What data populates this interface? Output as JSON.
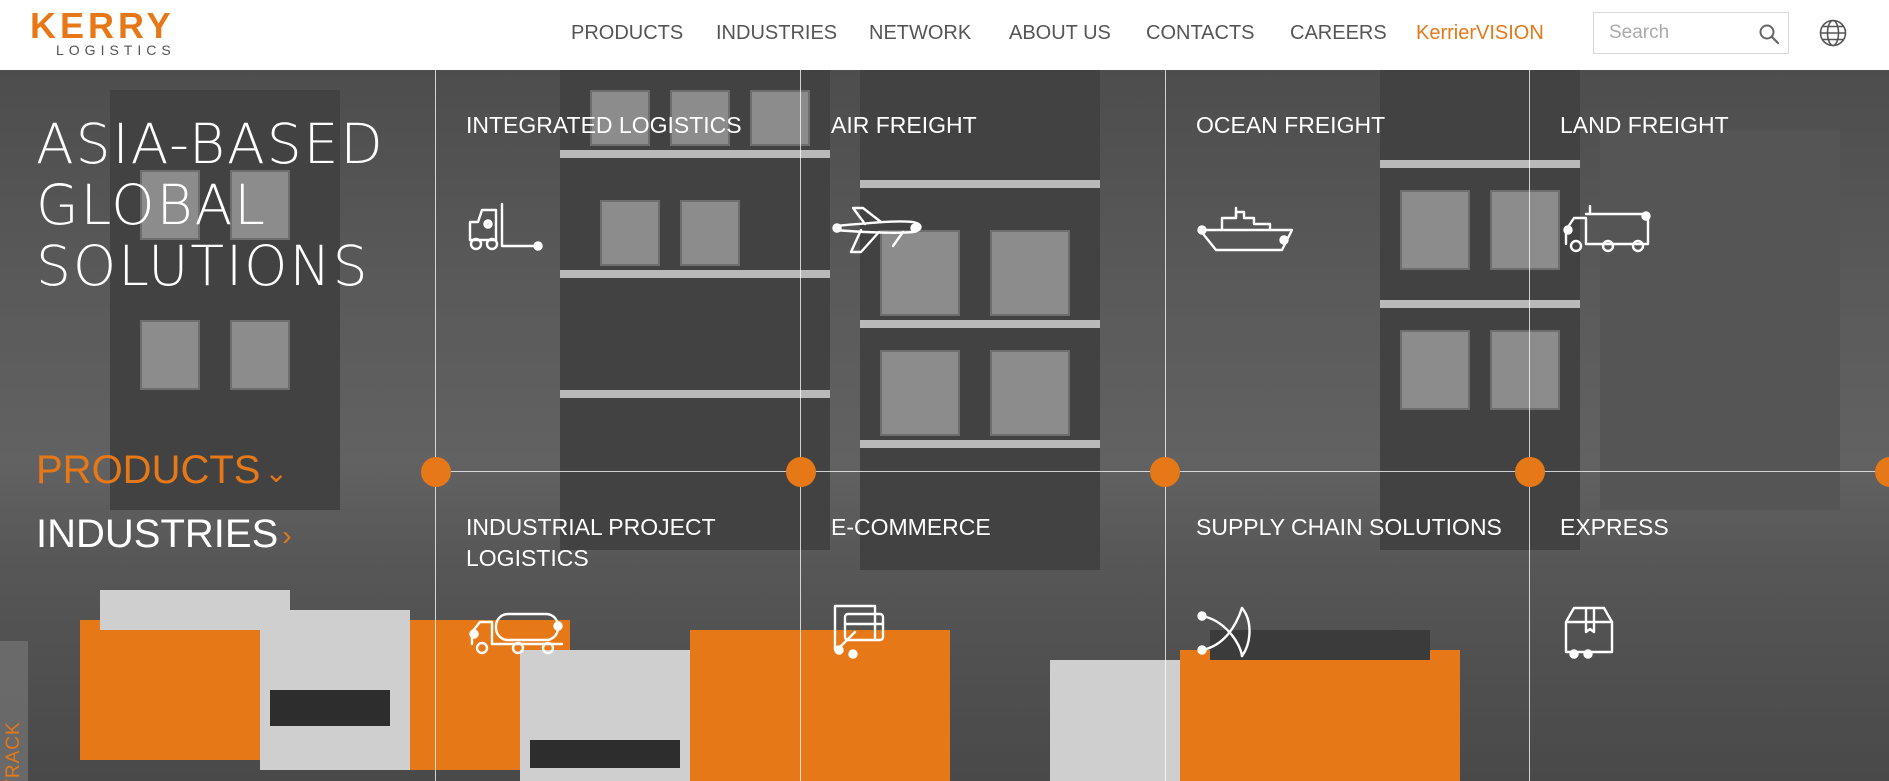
{
  "brand": {
    "name": "KERRY",
    "sub": "LOGISTICS",
    "accent": "#e67817"
  },
  "nav": {
    "items": [
      {
        "label": "PRODUCTS"
      },
      {
        "label": "INDUSTRIES"
      },
      {
        "label": "NETWORK"
      },
      {
        "label": "ABOUT US"
      },
      {
        "label": "CONTACTS"
      },
      {
        "label": "CAREERS"
      },
      {
        "label": "KerrierVISION",
        "accent": true
      }
    ]
  },
  "search": {
    "placeholder": "Search",
    "icon": "search-icon"
  },
  "language": {
    "icon": "globe-icon"
  },
  "hero": {
    "tagline": [
      "ASIA-BASED",
      "GLOBAL",
      "SOLUTIONS"
    ],
    "side_menu": {
      "products": "PRODUCTS",
      "industries": "INDUSTRIES"
    },
    "track": "TRACK"
  },
  "services": [
    {
      "title": "INTEGRATED LOGISTICS",
      "icon": "forklift-icon"
    },
    {
      "title": "AIR FREIGHT",
      "icon": "airplane-icon"
    },
    {
      "title": "OCEAN FREIGHT",
      "icon": "ship-icon"
    },
    {
      "title": "LAND FREIGHT",
      "icon": "truck-icon"
    },
    {
      "title": "INDUSTRIAL PROJECT LOGISTICS",
      "icon": "tanker-truck-icon"
    },
    {
      "title": "E-COMMERCE",
      "icon": "payment-card-icon"
    },
    {
      "title": "SUPPLY CHAIN SOLUTIONS",
      "icon": "network-icon"
    },
    {
      "title": "EXPRESS",
      "icon": "package-icon"
    }
  ]
}
